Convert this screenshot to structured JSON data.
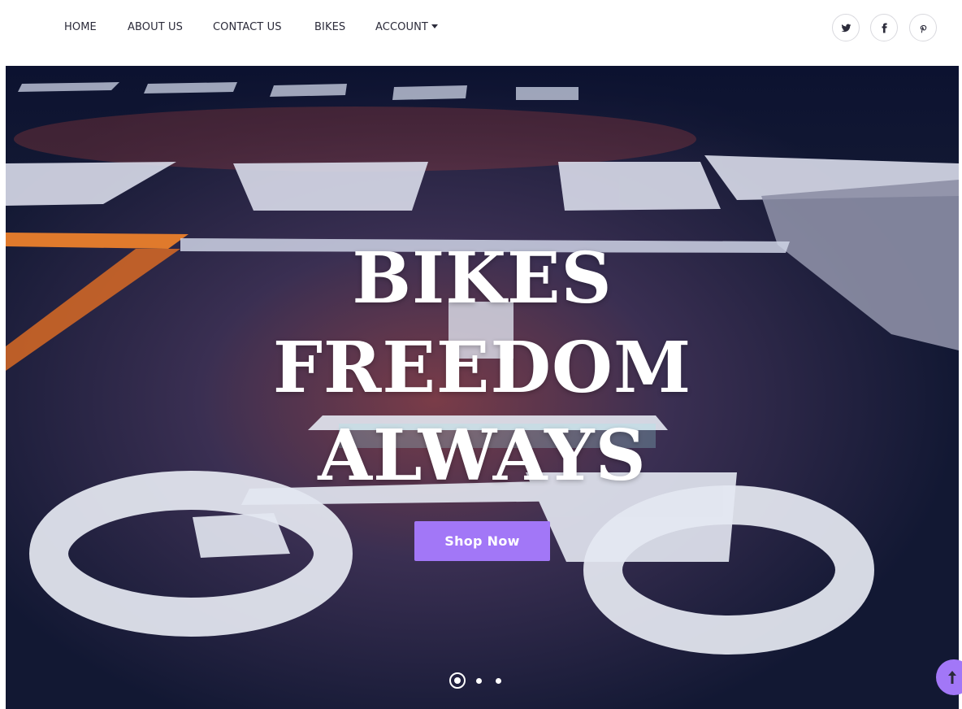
{
  "nav": {
    "items": [
      {
        "label": "HOME"
      },
      {
        "label": "ABOUT US"
      },
      {
        "label": "CONTACT US"
      },
      {
        "label": "BIKES"
      },
      {
        "label": "ACCOUNT"
      }
    ],
    "social": [
      {
        "icon": "twitter-icon"
      },
      {
        "icon": "facebook-icon"
      },
      {
        "icon": "pinterest-icon"
      }
    ]
  },
  "hero": {
    "heading_lines": [
      "BIKES",
      "FREEDOM",
      "ALWAYS"
    ],
    "cta_label": "Shop Now",
    "slides": {
      "count": 3,
      "active": 1
    }
  },
  "scroll_top": {
    "icon": "arrow-up-icon"
  },
  "colors": {
    "accent": "#a277f7",
    "nav_text": "#2b2b3a",
    "hero_text": "#ffffff"
  }
}
